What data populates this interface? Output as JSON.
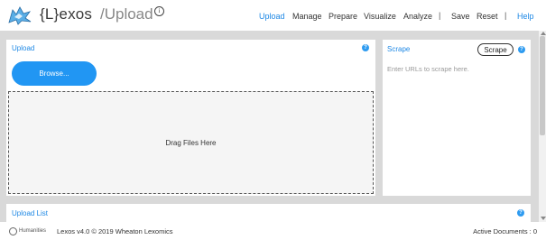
{
  "header": {
    "brand": "{L}exos",
    "page_name": "/Upload",
    "info_glyph": "i",
    "nav": [
      {
        "label": "Upload",
        "active": true
      },
      {
        "label": "Manage",
        "active": false
      },
      {
        "label": "Prepare",
        "active": false
      },
      {
        "label": "Visualize",
        "active": false
      },
      {
        "label": "Analyze",
        "active": false
      },
      {
        "label": "Save",
        "active": false
      },
      {
        "label": "Reset",
        "active": false
      },
      {
        "label": "Help",
        "active": false
      }
    ],
    "separator": "|"
  },
  "upload_panel": {
    "title": "Upload",
    "help": "?",
    "browse_label": "Browse...",
    "dropzone_text": "Drag Files Here"
  },
  "scrape_panel": {
    "title": "Scrape",
    "button_label": "Scrape",
    "help": "?",
    "placeholder": "Enter URLs to scrape here."
  },
  "upload_list": {
    "title": "Upload List",
    "help": "?"
  },
  "footer": {
    "logo_text": "Humanities",
    "credit": "Lexos v4.0 © 2019 Wheaton Lexomics",
    "active_documents": "Active Documents : 0"
  },
  "colors": {
    "accent": "#1e88e5",
    "button": "#2196f3",
    "workspace_bg": "#d9d9d9"
  }
}
